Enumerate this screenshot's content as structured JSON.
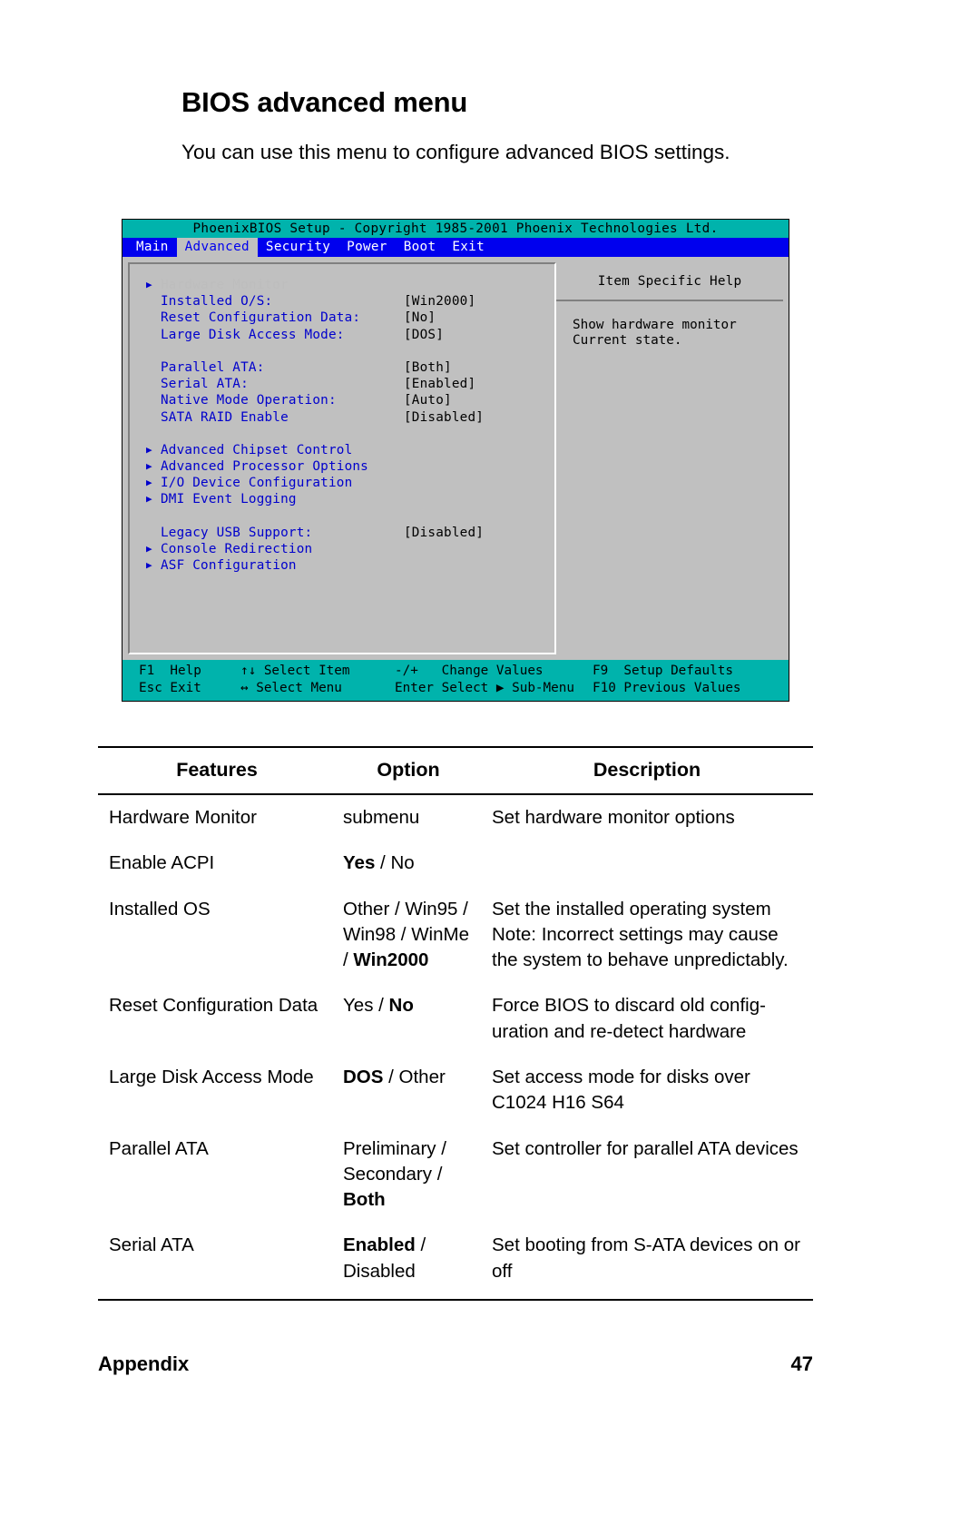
{
  "heading": {
    "title": "BIOS advanced menu",
    "subtitle": "You can use this menu to configure advanced BIOS settings."
  },
  "bios": {
    "titlebar": "PhoenixBIOS Setup - Copyright 1985-2001 Phoenix Technologies Ltd.",
    "menubar": [
      {
        "label": "Main",
        "active": false
      },
      {
        "label": "Advanced",
        "active": true
      },
      {
        "label": "Security",
        "active": false
      },
      {
        "label": "Power",
        "active": false
      },
      {
        "label": "Boot",
        "active": false
      },
      {
        "label": "Exit",
        "active": false
      }
    ],
    "items": [
      {
        "arrow": true,
        "label": "Hardware Monitor",
        "value": "",
        "highlighted": true
      },
      {
        "arrow": false,
        "label": "Installed O/S:",
        "value": "[Win2000]",
        "highlighted": false
      },
      {
        "arrow": false,
        "label": "Reset Configuration Data:",
        "value": "[No]",
        "highlighted": false
      },
      {
        "arrow": false,
        "label": "Large Disk Access Mode:",
        "value": "[DOS]",
        "highlighted": false
      },
      {
        "spacer": true
      },
      {
        "arrow": false,
        "label": "Parallel ATA:",
        "value": "[Both]",
        "highlighted": false
      },
      {
        "arrow": false,
        "label": "Serial ATA:",
        "value": "[Enabled]",
        "highlighted": false
      },
      {
        "arrow": false,
        "label": "Native Mode Operation:",
        "value": "[Auto]",
        "highlighted": false
      },
      {
        "arrow": false,
        "label": "SATA RAID Enable",
        "value": "[Disabled]",
        "highlighted": false
      },
      {
        "spacer": true
      },
      {
        "arrow": true,
        "label": "Advanced Chipset Control",
        "value": "",
        "highlighted": false
      },
      {
        "arrow": true,
        "label": "Advanced Processor Options",
        "value": "",
        "highlighted": false
      },
      {
        "arrow": true,
        "label": "I/O Device Configuration",
        "value": "",
        "highlighted": false
      },
      {
        "arrow": true,
        "label": "DMI Event Logging",
        "value": "",
        "highlighted": false
      },
      {
        "spacer": true
      },
      {
        "arrow": false,
        "label": "Legacy USB Support:",
        "value": "[Disabled]",
        "highlighted": false
      },
      {
        "arrow": true,
        "label": "Console Redirection",
        "value": "",
        "highlighted": false
      },
      {
        "arrow": true,
        "label": "ASF Configuration",
        "value": "",
        "highlighted": false
      }
    ],
    "help": {
      "title": "Item Specific Help",
      "body": "Show hardware monitor\nCurrent state."
    },
    "function_keys": {
      "row1": {
        "help": "F1  Help",
        "select_item": "↑↓ Select Item",
        "change_values": "-/+   Change Values",
        "setup_defaults": "F9  Setup Defaults"
      },
      "row2": {
        "exit": "Esc Exit",
        "select_menu": "↔ Select Menu",
        "submenu": "Enter Select ▶ Sub-Menu",
        "previous_values": "F10 Previous Values"
      }
    },
    "colors": {
      "titlebar": "#00b3ac",
      "menubar": "#0000ee",
      "body": "#c0c0c0",
      "item_text": "#0000cc",
      "value_text": "#000000"
    }
  },
  "table": {
    "headers": [
      "Features",
      "Option",
      "Description"
    ],
    "rows": [
      {
        "feature": "Hardware Monitor",
        "option_html": "submenu",
        "description": "Set hardware monitor options"
      },
      {
        "feature": "Enable ACPI",
        "option_html": "<b>Yes</b> / No",
        "description": ""
      },
      {
        "feature": "Installed OS",
        "option_html": "Other / Win95 / Win98 / WinMe / <b>Win2000</b>",
        "description": "Set the installed operating system Note: Incorrect settings may cause the system to behave unpredictably."
      },
      {
        "feature": "Reset Configuration Data",
        "option_html": "Yes / <b>No</b>",
        "description": "Force BIOS to discard old config-uration and re-detect hardware"
      },
      {
        "feature": "Large Disk Access Mode",
        "option_html": "<b>DOS</b> / Other",
        "description": "Set access mode for disks over C1024 H16 S64"
      },
      {
        "feature": "Parallel ATA",
        "option_html": "Preliminary / Secondary / <b>Both</b>",
        "description": "Set controller for parallel ATA devices"
      },
      {
        "feature": "Serial ATA",
        "option_html": "<b>Enabled</b> / Disabled",
        "description": "Set booting from S-ATA devices on or off"
      }
    ]
  },
  "footer": {
    "section": "Appendix",
    "page_number": "47"
  }
}
